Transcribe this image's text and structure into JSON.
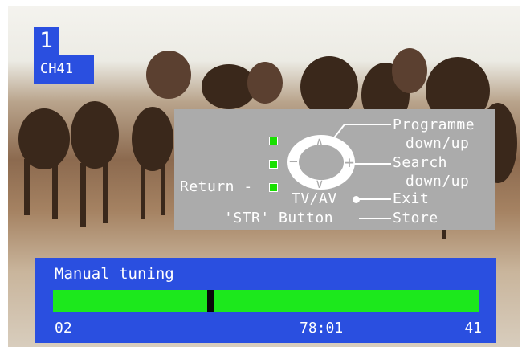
{
  "channel": {
    "number": "1",
    "name": "CH41"
  },
  "help_panel": {
    "programme_line1": "Programme",
    "programme_line2": "down/up",
    "search_line1": "Search",
    "search_line2": "down/up",
    "return_label": "Return -",
    "tvav_label": "TV/AV",
    "exit_label": "Exit",
    "str_label": "'STR' Button",
    "store_label": "Store",
    "plus_symbol": "+",
    "minus_symbol": "−",
    "up_symbol": "∧",
    "down_symbol": "∨"
  },
  "tuning": {
    "title": "Manual tuning",
    "start_value": "02",
    "frequency": "78:01",
    "end_value": "41",
    "position_fraction": 0.37
  },
  "colors": {
    "osd_blue": "#2a4fe0",
    "bar_green": "#1ce81c",
    "panel_grey": "#ababab",
    "indicator_green": "#18e000"
  },
  "icons": {
    "remote_pad": "navigation-pad-icon",
    "exit_dot": "dot-icon"
  }
}
